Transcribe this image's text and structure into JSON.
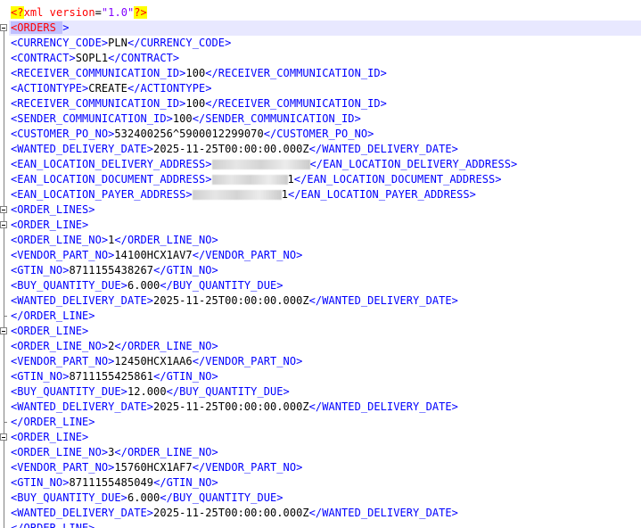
{
  "xml_decl": {
    "open": "<?",
    "name": "xml ",
    "attr": "version",
    "eq": "=",
    "value": "\"1.0\"",
    "close": "?>"
  },
  "lines": [
    {
      "kind": "root",
      "open": "<ORDERS ",
      "close": ">"
    },
    {
      "kind": "elem",
      "tag": "CURRENCY_CODE",
      "value": "PLN"
    },
    {
      "kind": "elem",
      "tag": "CONTRACT",
      "value": "SOPL1"
    },
    {
      "kind": "elem",
      "tag": "RECEIVER_COMMUNICATION_ID",
      "value": "100"
    },
    {
      "kind": "elem",
      "tag": "ACTIONTYPE",
      "value": "CREATE"
    },
    {
      "kind": "elem",
      "tag": "RECEIVER_COMMUNICATION_ID",
      "value": "100"
    },
    {
      "kind": "elem",
      "tag": "SENDER_COMMUNICATION_ID",
      "value": "100"
    },
    {
      "kind": "elem",
      "tag": "CUSTOMER_PO_NO",
      "value": "532400256^5900012299070"
    },
    {
      "kind": "elem",
      "tag": "WANTED_DELIVERY_DATE",
      "value": "2025-11-25T00:00:00.000Z"
    },
    {
      "kind": "redacted",
      "tag": "EAN_LOCATION_DELIVERY_ADDRESS",
      "value": ""
    },
    {
      "kind": "redacted",
      "tag": "EAN_LOCATION_DOCUMENT_ADDRESS",
      "value": "1"
    },
    {
      "kind": "redacted",
      "tag": "EAN_LOCATION_PAYER_ADDRESS",
      "value": "1"
    },
    {
      "kind": "open",
      "tag": "ORDER_LINES"
    },
    {
      "kind": "open",
      "tag": "ORDER_LINE"
    },
    {
      "kind": "elem",
      "tag": "ORDER_LINE_NO",
      "value": "1"
    },
    {
      "kind": "elem",
      "tag": "VENDOR_PART_NO",
      "value": "14100HCX1AV7"
    },
    {
      "kind": "elem",
      "tag": "GTIN_NO",
      "value": "8711155438267"
    },
    {
      "kind": "elem",
      "tag": "BUY_QUANTITY_DUE",
      "value": "6.000"
    },
    {
      "kind": "elem",
      "tag": "WANTED_DELIVERY_DATE",
      "value": "2025-11-25T00:00:00.000Z"
    },
    {
      "kind": "close",
      "tag": "ORDER_LINE"
    },
    {
      "kind": "open",
      "tag": "ORDER_LINE"
    },
    {
      "kind": "elem",
      "tag": "ORDER_LINE_NO",
      "value": "2"
    },
    {
      "kind": "elem",
      "tag": "VENDOR_PART_NO",
      "value": "12450HCX1AA6"
    },
    {
      "kind": "elem",
      "tag": "GTIN_NO",
      "value": "8711155425861"
    },
    {
      "kind": "elem",
      "tag": "BUY_QUANTITY_DUE",
      "value": "12.000"
    },
    {
      "kind": "elem",
      "tag": "WANTED_DELIVERY_DATE",
      "value": "2025-11-25T00:00:00.000Z"
    },
    {
      "kind": "close",
      "tag": "ORDER_LINE"
    },
    {
      "kind": "open",
      "tag": "ORDER_LINE"
    },
    {
      "kind": "elem",
      "tag": "ORDER_LINE_NO",
      "value": "3"
    },
    {
      "kind": "elem",
      "tag": "VENDOR_PART_NO",
      "value": "15760HCX1AF7"
    },
    {
      "kind": "elem",
      "tag": "GTIN_NO",
      "value": "8711155485049"
    },
    {
      "kind": "elem",
      "tag": "BUY_QUANTITY_DUE",
      "value": "6.000"
    },
    {
      "kind": "elem",
      "tag": "WANTED_DELIVERY_DATE",
      "value": "2025-11-25T00:00:00.000Z"
    },
    {
      "kind": "close",
      "tag": "ORDER_LINE"
    }
  ],
  "colors": {
    "tag": "#0000ff",
    "text": "#000000",
    "decl": "#ff0000",
    "attr_value": "#8000ff",
    "current_line": "#e8e8ff",
    "fold_margin": "#808080"
  }
}
